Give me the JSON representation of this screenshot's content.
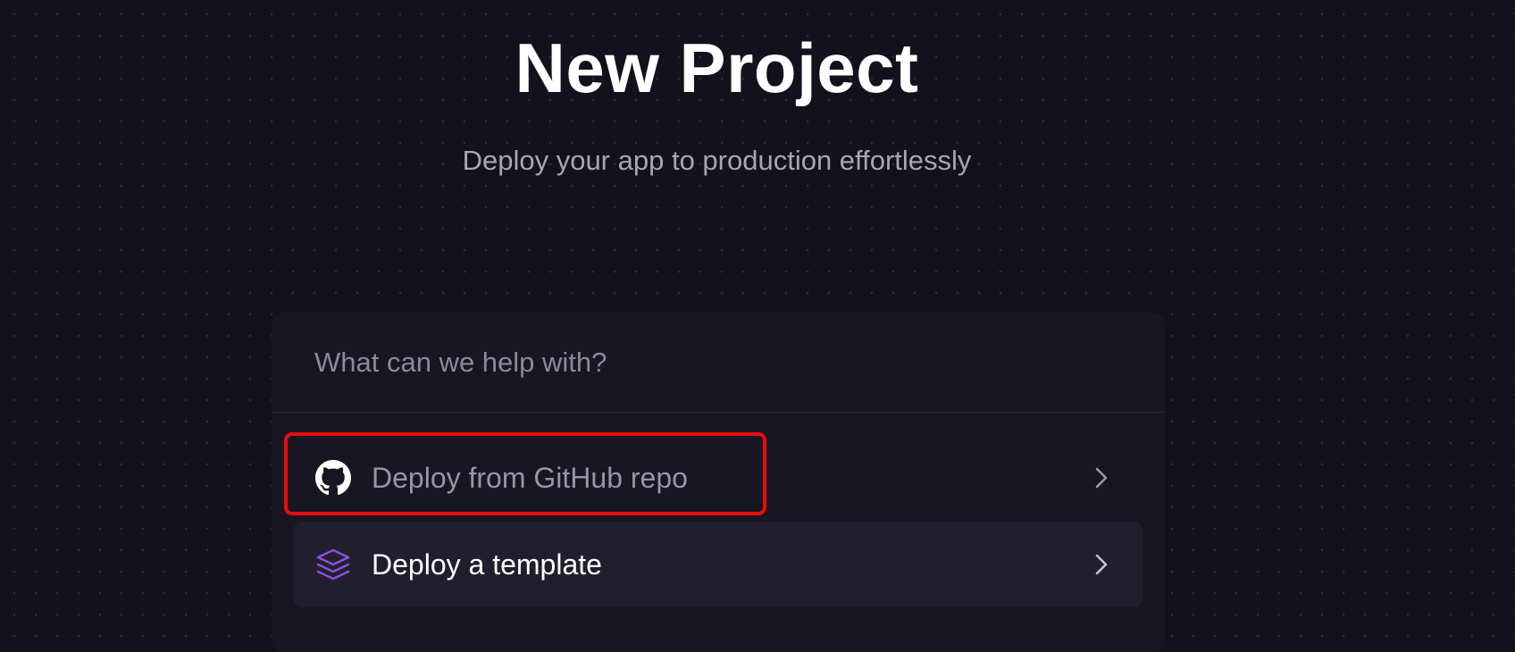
{
  "header": {
    "title": "New Project",
    "subtitle": "Deploy your app to production effortlessly"
  },
  "search": {
    "placeholder": "What can we help with?",
    "value": ""
  },
  "options": [
    {
      "label": "Deploy from GitHub repo",
      "icon": "github-icon",
      "trailing_icon": "chevron-right-icon"
    },
    {
      "label": "Deploy a template",
      "icon": "layers-icon",
      "trailing_icon": "chevron-right-icon"
    }
  ],
  "annotation": {
    "highlight_target": "Deploy from GitHub repo",
    "highlight_color": "#e01010"
  },
  "colors": {
    "background": "#13111c",
    "panel": "#181622",
    "selected_option": "#211f2d",
    "template_icon_accent": "#8b4fd8"
  }
}
